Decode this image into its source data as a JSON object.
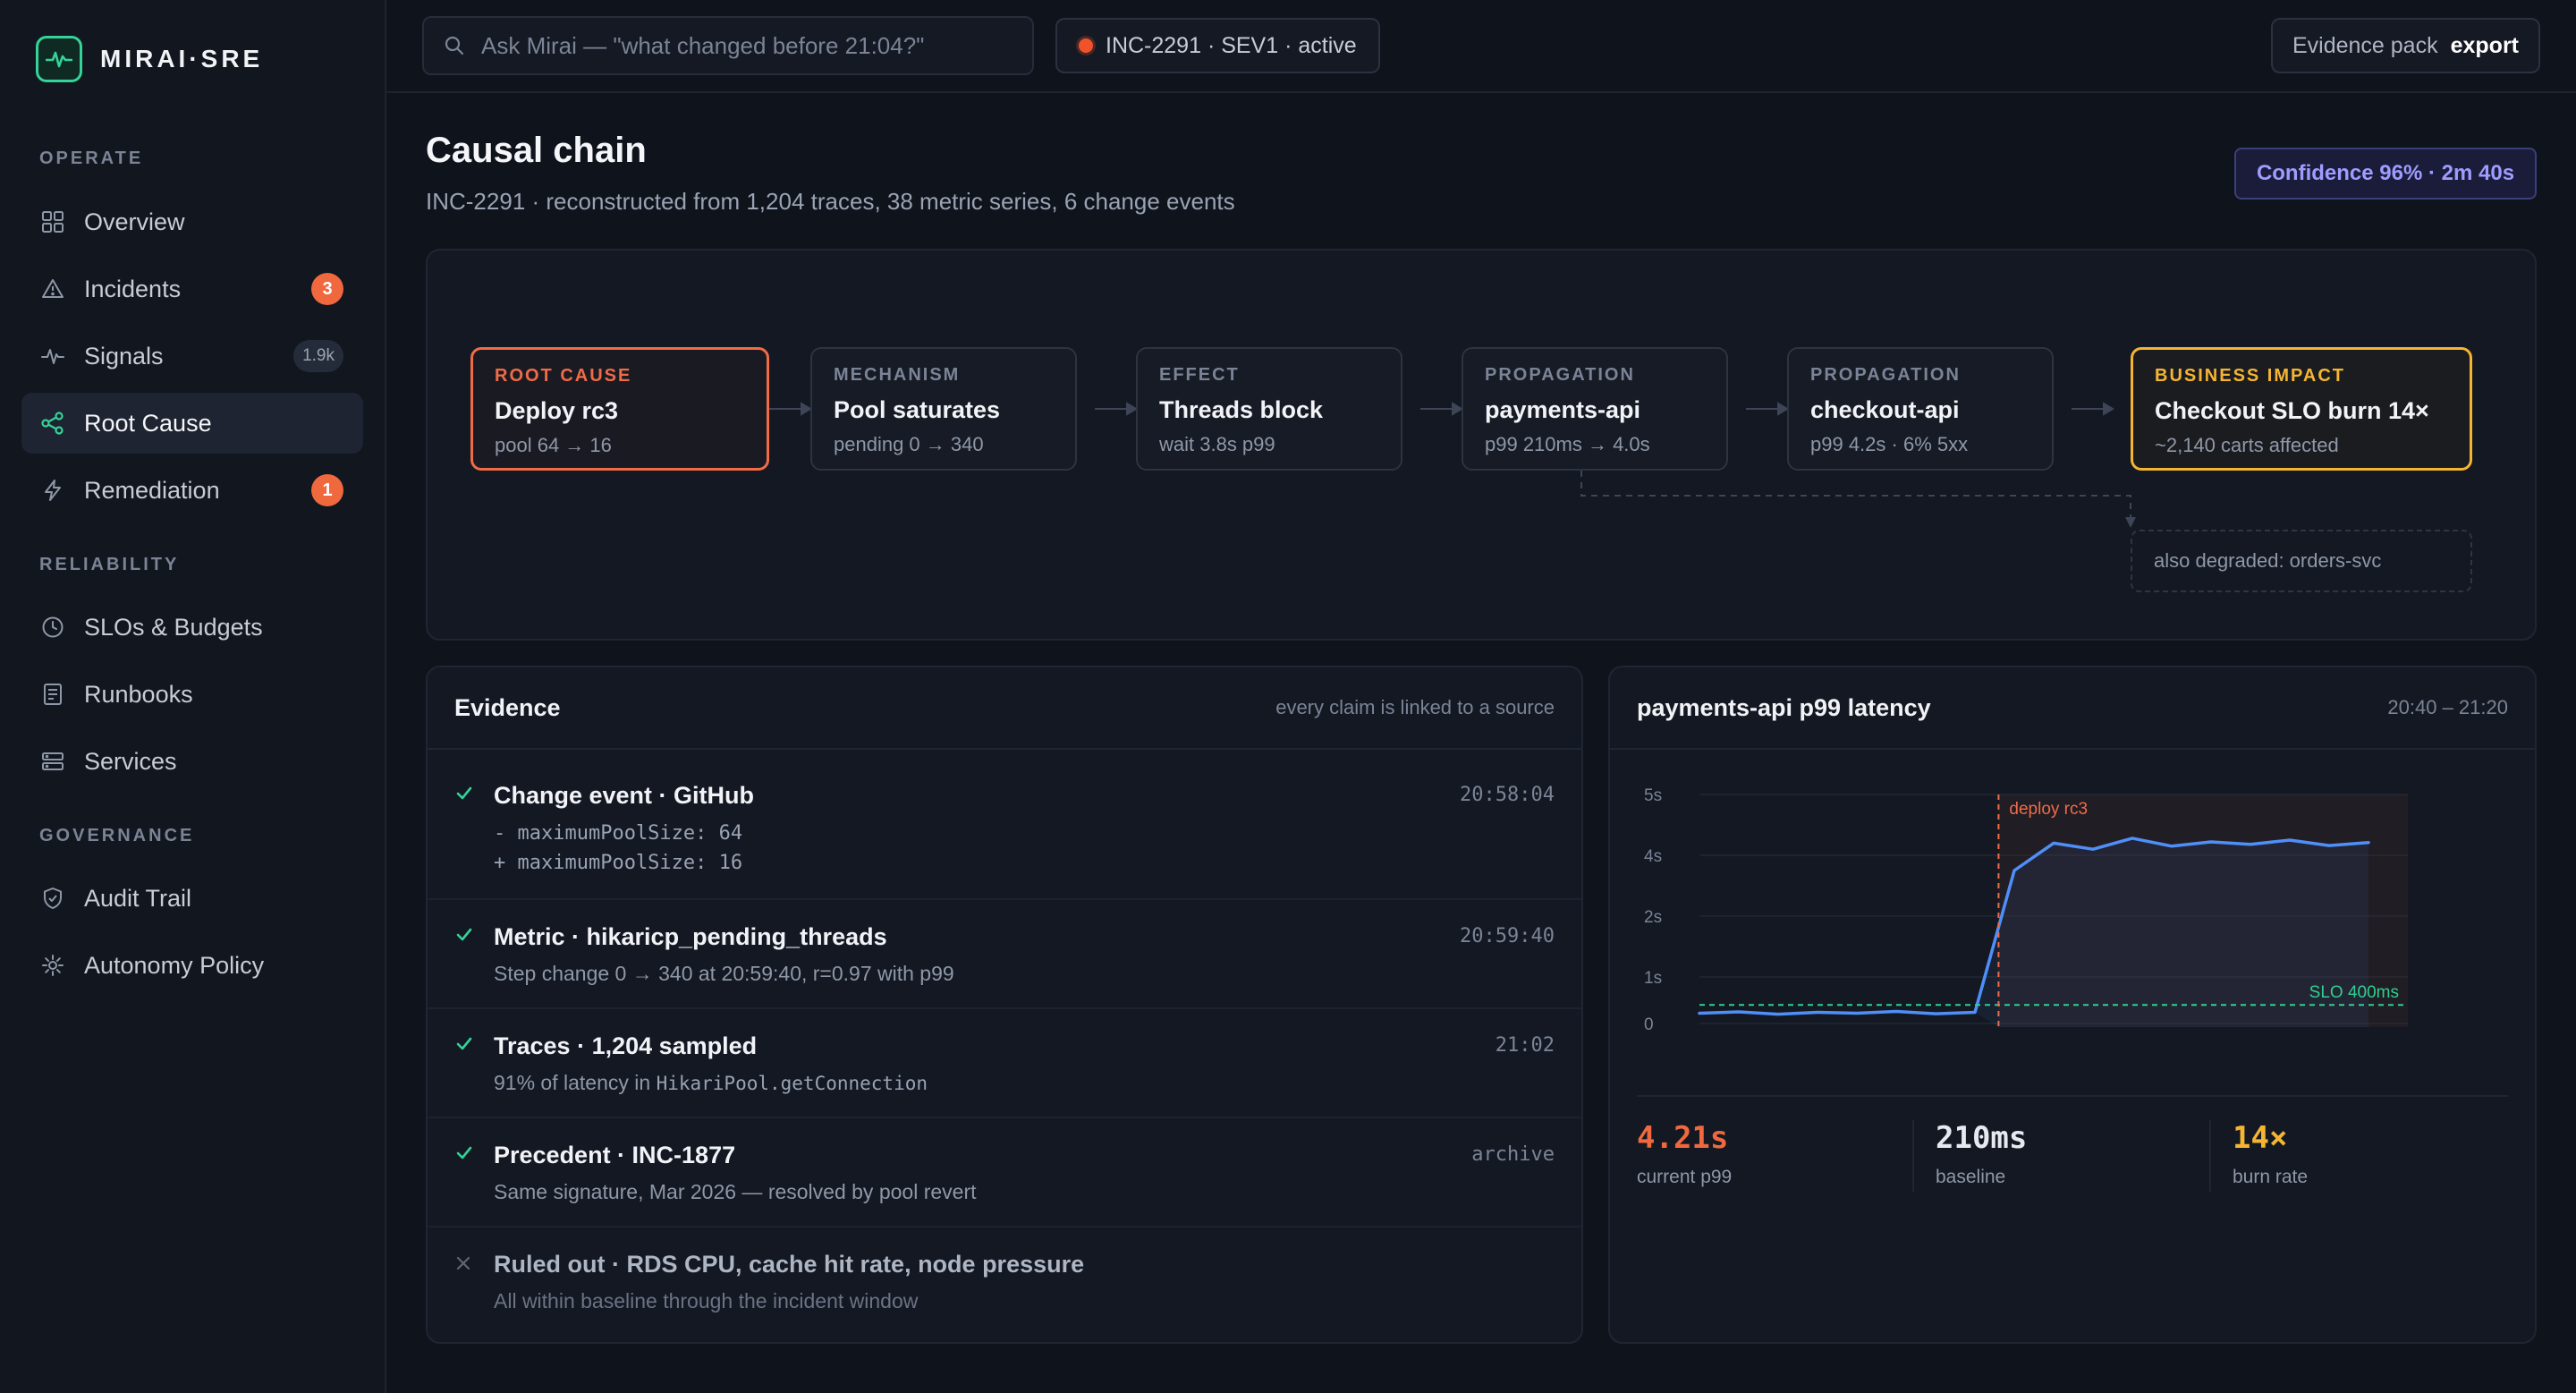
{
  "brand": {
    "name": "MIRAI·SRE",
    "logo_icon": "pulse-icon",
    "accent": "#34d399"
  },
  "sidebar": {
    "sections": [
      {
        "label": "OPERATE"
      },
      {
        "label": "RELIABILITY"
      },
      {
        "label": "GOVERNANCE"
      }
    ],
    "items": [
      {
        "label": "Overview",
        "icon": "grid-icon"
      },
      {
        "label": "Incidents",
        "icon": "alert-triangle-icon",
        "badge": "3"
      },
      {
        "label": "Signals",
        "icon": "pulse-icon",
        "badge": "1.9k"
      },
      {
        "label": "Root Cause",
        "icon": "share-nodes-icon",
        "active": true
      },
      {
        "label": "Remediation",
        "icon": "bolt-icon",
        "badge": "1"
      },
      {
        "label": "SLOs & Budgets",
        "icon": "clock-icon"
      },
      {
        "label": "Runbooks",
        "icon": "document-icon"
      },
      {
        "label": "Services",
        "icon": "server-icon"
      },
      {
        "label": "Audit Trail",
        "icon": "shield-check-icon"
      },
      {
        "label": "Autonomy Policy",
        "icon": "gear-icon"
      }
    ]
  },
  "topbar": {
    "search_placeholder": "Ask Mirai — \"what changed before 21:04?\"",
    "incident": "INC-2291 · SEV1 · active",
    "evidence_label": "Evidence pack",
    "evidence_action": "export"
  },
  "header": {
    "title": "Causal chain",
    "subtitle": "INC-2291 · reconstructed from 1,204 traces, 38 metric series, 6 change events",
    "confidence": "Confidence 96% · 2m 40s"
  },
  "chain": {
    "nodes": [
      {
        "tag": "ROOT CAUSE",
        "title": "Deploy rc3",
        "meta": "pool 64 → 16"
      },
      {
        "tag": "MECHANISM",
        "title": "Pool saturates",
        "meta": "pending 0 → 340"
      },
      {
        "tag": "EFFECT",
        "title": "Threads block",
        "meta": "wait 3.8s p99"
      },
      {
        "tag": "PROPAGATION",
        "title": "payments-api",
        "meta": "p99 210ms → 4.0s"
      },
      {
        "tag": "PROPAGATION",
        "title": "checkout-api",
        "meta": "p99 4.2s · 6% 5xx"
      },
      {
        "tag": "BUSINESS IMPACT",
        "title": "Checkout SLO burn 14×",
        "meta": "~2,140 carts affected"
      }
    ],
    "also_degraded": "also degraded: orders-svc"
  },
  "evidence": {
    "title": "Evidence",
    "note": "every claim is linked to a source",
    "rows": [
      {
        "title": "Change event · GitHub",
        "time": "20:58:04",
        "code1": "- maximumPoolSize: 64",
        "code2": "+ maximumPoolSize: 16"
      },
      {
        "title": "Metric · hikaricp_pending_threads",
        "time": "20:59:40",
        "detail": "Step change 0 → 340 at 20:59:40, r=0.97 with p99"
      },
      {
        "title": "Traces · 1,204 sampled",
        "time": "21:02",
        "detail": "91% of latency in",
        "detail_code": "HikariPool.getConnection"
      },
      {
        "title": "Precedent · INC-1877",
        "time": "archive",
        "detail": "Same signature, Mar 2026 — resolved by pool revert"
      },
      {
        "title": "Ruled out · RDS CPU, cache hit rate, node pressure",
        "detail": "All within baseline through the incident window"
      }
    ]
  },
  "latency": {
    "title": "payments-api p99 latency",
    "range": "20:40 – 21:20",
    "stats": [
      {
        "value": "4.21s",
        "label": "current p99",
        "color": "#f0683e"
      },
      {
        "value": "210ms",
        "label": "baseline",
        "color": "#e6e9ef"
      },
      {
        "value": "14×",
        "label": "burn rate",
        "color": "#f5b533"
      }
    ]
  },
  "chart_data": {
    "type": "line",
    "title": "payments-api p99 latency",
    "yticks": [
      "5s",
      "4s",
      "2s",
      "1s",
      "0"
    ],
    "series": [
      {
        "values": [
          0.22,
          0.25,
          0.2,
          0.24,
          0.22,
          0.26,
          0.21,
          0.24,
          3.5,
          4.2,
          4.1,
          4.28,
          4.15,
          4.22,
          4.18,
          4.25,
          4.16,
          4.21
        ],
        "color": "#4f8ff7"
      }
    ],
    "annotations": [
      {
        "label": "deploy rc3",
        "color": "#ef6c47"
      },
      {
        "label": "SLO 400ms",
        "color": "#2fcf8f"
      }
    ]
  }
}
